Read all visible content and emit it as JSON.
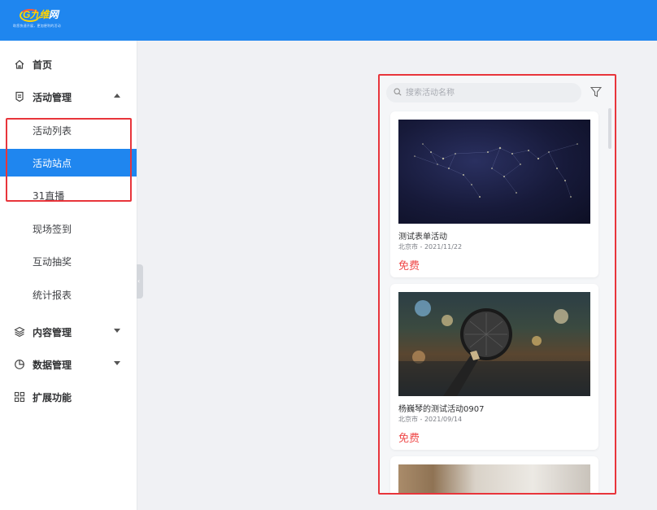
{
  "header": {
    "logo_text": "G九维",
    "logo_mark_rest": "网",
    "logo_tagline": "助您快速开展，更加便利的活动"
  },
  "sidebar": {
    "items": [
      {
        "label": "首页",
        "icon": "home-icon"
      },
      {
        "label": "活动管理",
        "icon": "document-icon",
        "expanded": true,
        "children": [
          {
            "label": "活动列表"
          },
          {
            "label": "活动站点",
            "active": true
          },
          {
            "label": "31直播"
          },
          {
            "label": "现场签到"
          },
          {
            "label": "互动抽奖"
          },
          {
            "label": "统计报表"
          }
        ]
      },
      {
        "label": "内容管理",
        "icon": "layers-icon",
        "expanded": false
      },
      {
        "label": "数据管理",
        "icon": "pie-chart-icon",
        "expanded": false
      },
      {
        "label": "扩展功能",
        "icon": "grid-icon"
      }
    ]
  },
  "colors": {
    "accent": "#1f86ef",
    "highlight_box": "#e8353b",
    "price": "#ef4a4a"
  },
  "preview": {
    "search_placeholder": "搜索活动名称",
    "cards": [
      {
        "title": "测试表单活动",
        "meta": "北京市 - 2021/11/22",
        "price": "免费",
        "image": "world-network-map"
      },
      {
        "title": "杨巍琴的测试活动0907",
        "meta": "北京市 - 2021/09/14",
        "price": "免费",
        "image": "microphone-stage"
      },
      {
        "title": "",
        "meta": "",
        "price": "",
        "image": "room-interior"
      }
    ]
  }
}
